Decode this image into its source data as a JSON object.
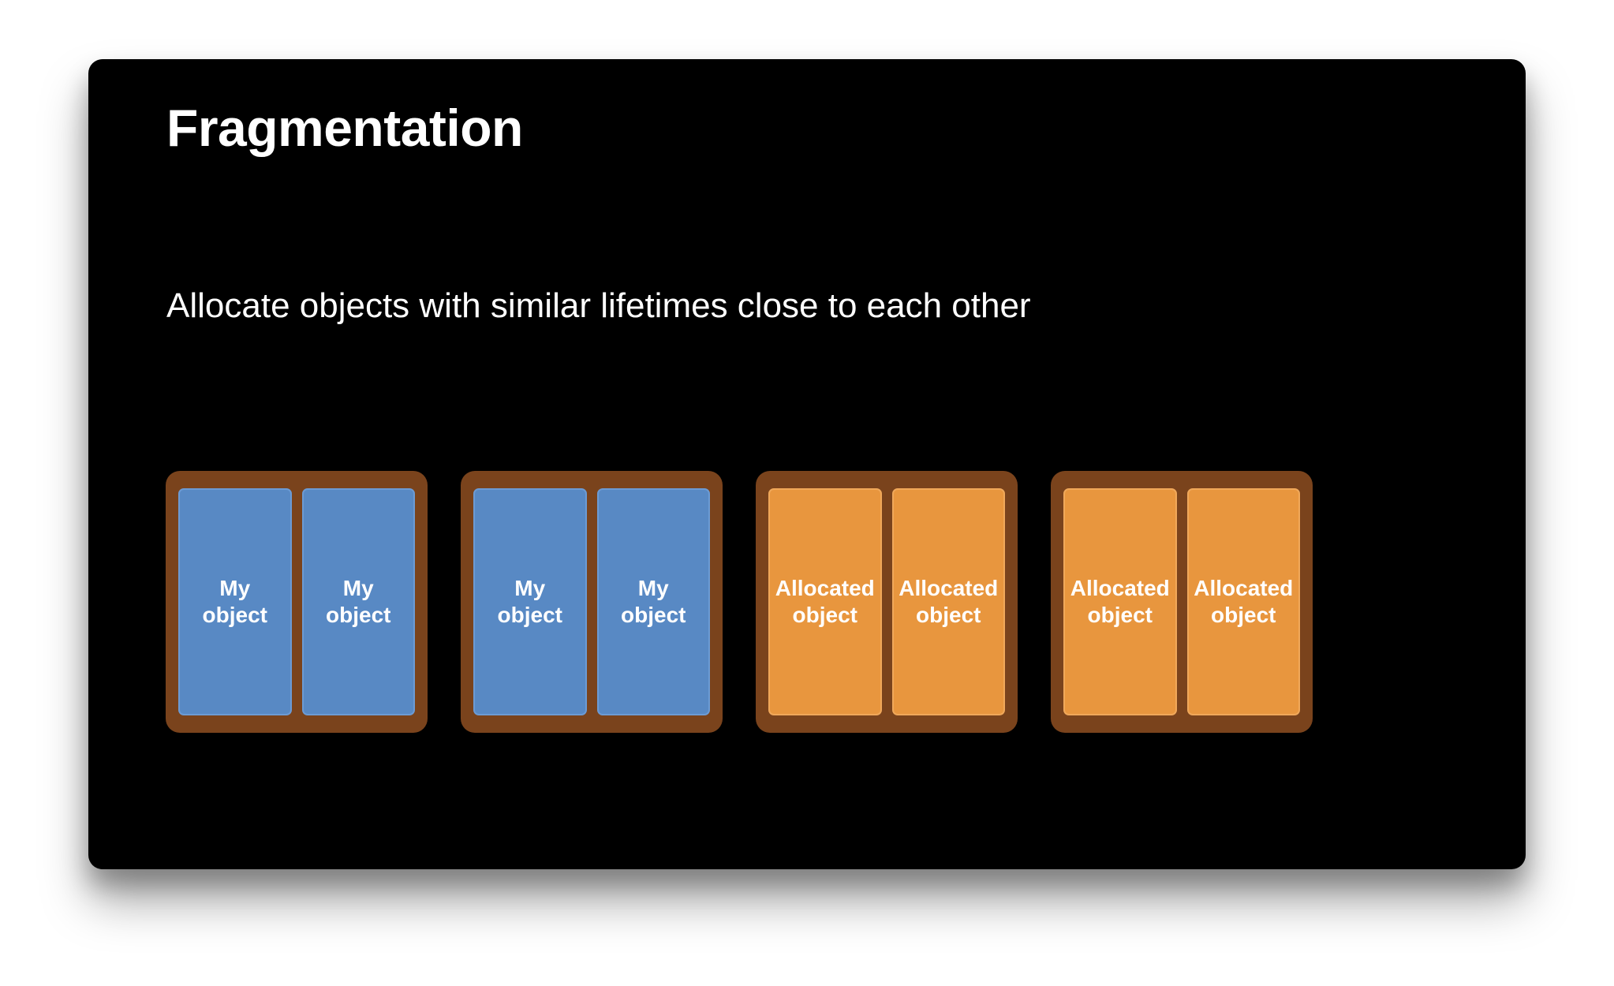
{
  "slide": {
    "title": "Fragmentation",
    "subtitle": "Allocate objects with similar lifetimes close to each other"
  },
  "colors": {
    "background": "#000000",
    "block_container": "#7a431c",
    "my_object": "#5889c4",
    "allocated_object": "#e8963e",
    "text": "#ffffff"
  },
  "blocks": [
    {
      "objects": [
        {
          "label": "My\nobject",
          "kind": "mine"
        },
        {
          "label": "My\nobject",
          "kind": "mine"
        }
      ]
    },
    {
      "objects": [
        {
          "label": "My\nobject",
          "kind": "mine"
        },
        {
          "label": "My\nobject",
          "kind": "mine"
        }
      ]
    },
    {
      "objects": [
        {
          "label": "Allocated\nobject",
          "kind": "alloc"
        },
        {
          "label": "Allocated\nobject",
          "kind": "alloc"
        }
      ]
    },
    {
      "objects": [
        {
          "label": "Allocated\nobject",
          "kind": "alloc"
        },
        {
          "label": "Allocated\nobject",
          "kind": "alloc"
        }
      ]
    }
  ]
}
